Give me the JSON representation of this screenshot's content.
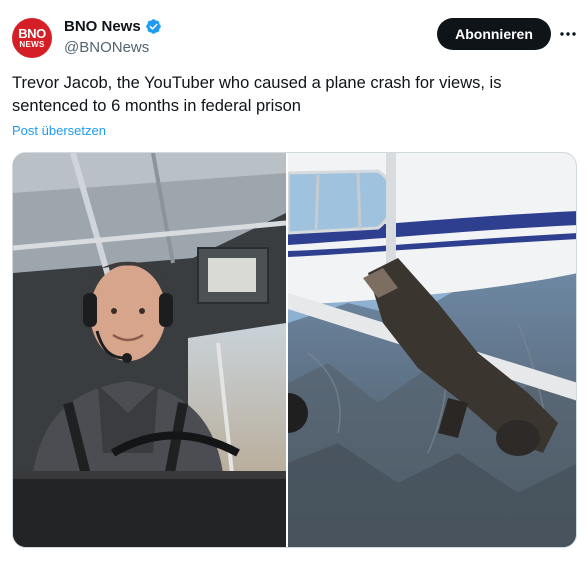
{
  "account": {
    "avatar_line1": "BNO",
    "avatar_line2": "NEWS",
    "name": "BNO News",
    "handle": "@BNONews",
    "verified": true
  },
  "actions": {
    "follow_label": "Abonnieren",
    "more_icon": "more-horizontal-icon"
  },
  "tweet": {
    "text": "Trevor Jacob, the YouTuber who caused a plane crash for views, is sentenced to 6 months in federal prison",
    "translate_label": "Post übersetzen"
  },
  "media": {
    "images": [
      {
        "subject": "pilot-in-cockpit"
      },
      {
        "subject": "jumping-from-plane"
      }
    ]
  },
  "colors": {
    "avatar": "#d51f26",
    "verified": "#1d9bf0",
    "link": "#1d9bf0",
    "follow_button": "#0f1419",
    "handle": "#536471"
  }
}
